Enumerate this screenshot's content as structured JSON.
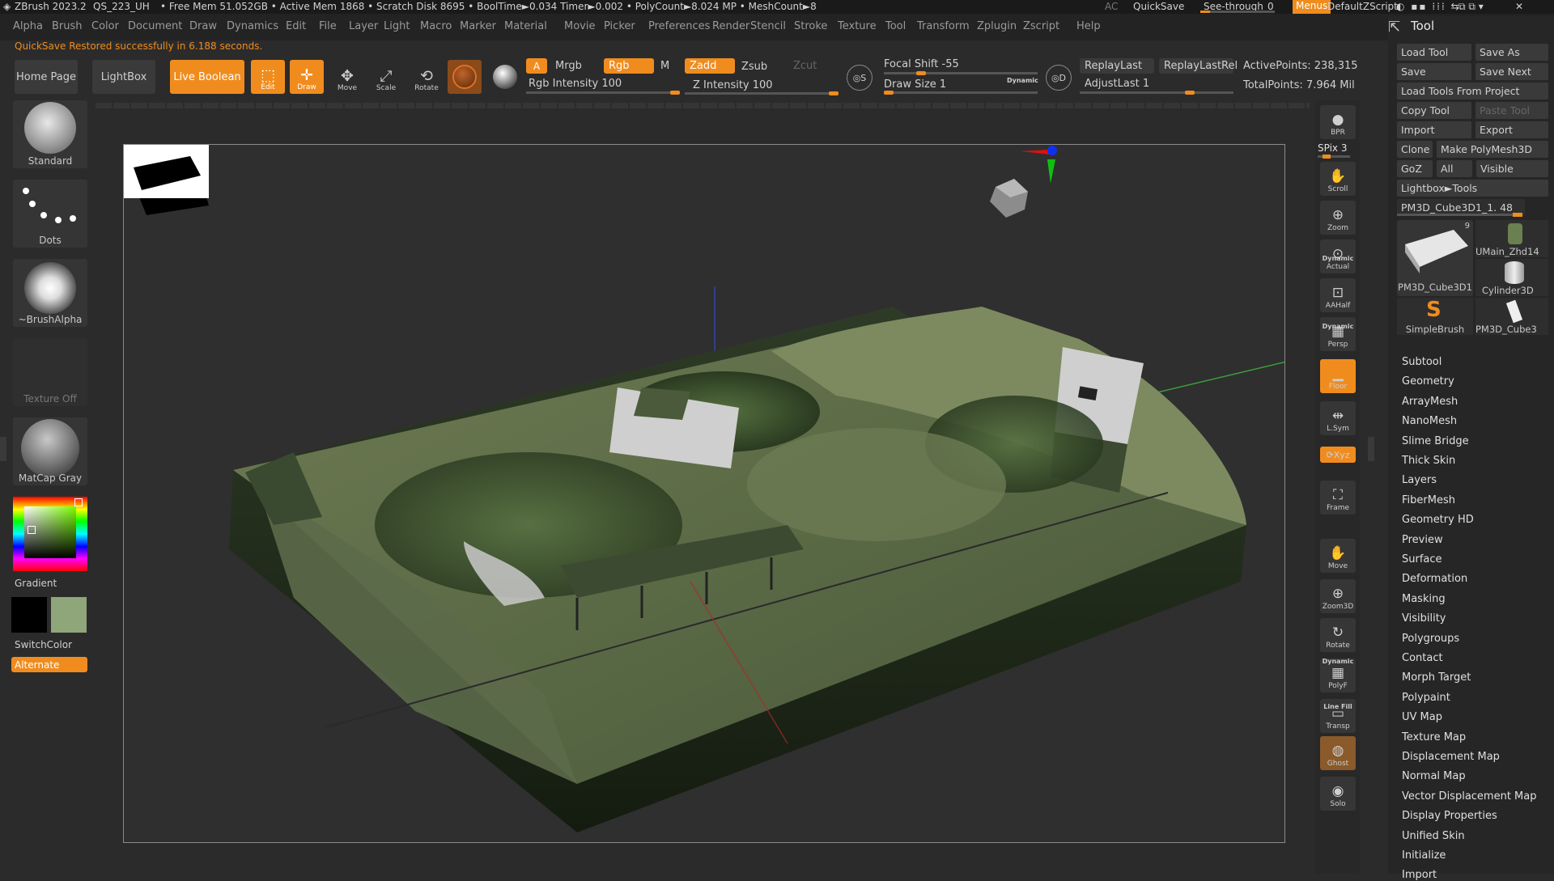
{
  "titlebar": {
    "app": "ZBrush 2023.2",
    "doc": "QS_223_UH",
    "stats": "• Free Mem 51.052GB • Active Mem 1868 • Scratch Disk 8695 • BoolTime►0.034 Timer►0.002 • PolyCount►8.024 MP • MeshCount►8",
    "ac": "AC",
    "quicksave": "QuickSave",
    "seethrough": "See-through",
    "seethrough_value": "0",
    "menus": "Menus",
    "script": "DefaultZScript"
  },
  "menubar": [
    "Alpha",
    "Brush",
    "Color",
    "Document",
    "Draw",
    "Dynamics",
    "Edit",
    "File",
    "Layer",
    "Light",
    "Macro",
    "Marker",
    "Material",
    "Movie",
    "Picker",
    "Preferences",
    "Render",
    "Stencil",
    "Stroke",
    "Texture",
    "Tool",
    "Transform",
    "Zplugin",
    "Zscript",
    "Help"
  ],
  "status_message": "QuickSave Restored successfully in 6.188 seconds.",
  "shelf": {
    "home_page": "Home Page",
    "lightbox": "LightBox",
    "live_boolean": "Live Boolean",
    "edit": "Edit",
    "draw": "Draw",
    "move": "Move",
    "scale": "Scale",
    "rotate": "Rotate",
    "a": "A",
    "mrgb": "Mrgb",
    "rgb": "Rgb",
    "m": "M",
    "zadd": "Zadd",
    "zsub": "Zsub",
    "zcut": "Zcut",
    "rgb_intensity": "Rgb Intensity 100",
    "z_intensity": "Z Intensity 100",
    "focal_shift": "Focal Shift -55",
    "draw_size": "Draw Size 1",
    "dynamic": "Dynamic",
    "replay_last": "ReplayLast",
    "replay_last_rel": "ReplayLastRel",
    "adjust_last": "AdjustLast 1",
    "active_points": "ActivePoints: 238,315",
    "total_points": "TotalPoints: 7.964 Mil"
  },
  "left_panel": {
    "brush": "Standard",
    "stroke": "Dots",
    "alpha": "~BrushAlpha",
    "texture": "Texture Off",
    "material": "MatCap Gray",
    "gradient": "Gradient",
    "switch_color": "SwitchColor",
    "alternate": "Alternate",
    "main_color": "#000000",
    "secondary_color": "#8fa57a"
  },
  "right_strip": [
    {
      "label": "BPR",
      "icon": "bpr-icon"
    },
    {
      "label": "SPix 3",
      "icon": "spix-slider"
    },
    {
      "label": "Scroll",
      "icon": "scroll-icon"
    },
    {
      "label": "Zoom",
      "icon": "zoom-icon"
    },
    {
      "label": "Actual",
      "icon": "actual-icon"
    },
    {
      "label": "AAHalf",
      "icon": "aahalf-icon"
    },
    {
      "label": "Persp",
      "icon": "persp-icon"
    },
    {
      "label": "Floor",
      "icon": "floor-icon"
    },
    {
      "label": "L.Sym",
      "icon": "lsym-icon"
    },
    {
      "label": "Xyz",
      "icon": "xyz-icon"
    },
    {
      "label": "Frame",
      "icon": "frame-icon"
    },
    {
      "label": "Move",
      "icon": "move-icon"
    },
    {
      "label": "Zoom3D",
      "icon": "zoom3d-icon"
    },
    {
      "label": "Rotate",
      "icon": "rotate-icon"
    },
    {
      "label": "PolyF",
      "icon": "polyf-icon"
    },
    {
      "label": "Transp",
      "icon": "transp-icon"
    },
    {
      "label": "Ghost",
      "icon": "ghost-icon"
    },
    {
      "label": "Solo",
      "icon": "solo-icon"
    }
  ],
  "right_strip_extra": {
    "dynamic": "Dynamic",
    "line_fill": "Line Fill"
  },
  "tool_panel": {
    "title": "Tool",
    "load_tool": "Load Tool",
    "save_as": "Save As",
    "save": "Save",
    "save_next": "Save Next",
    "load_from_project": "Load Tools From Project",
    "copy_tool": "Copy Tool",
    "paste_tool": "Paste Tool",
    "import": "Import",
    "export": "Export",
    "clone": "Clone",
    "make_polymesh": "Make PolyMesh3D",
    "goz": "GoZ",
    "all": "All",
    "visible": "Visible",
    "lightbox_tools": "Lightbox►Tools",
    "current_tool": "PM3D_Cube3D1_1. 48",
    "thumbs": [
      "PM3D_Cube3D1",
      "UMain_Zhd14",
      "Cylinder3D",
      "SimpleBrush",
      "PM3D_Cube3"
    ],
    "thumb_count": "9",
    "subpalettes": [
      "Subtool",
      "Geometry",
      "ArrayMesh",
      "NanoMesh",
      "Slime Bridge",
      "Thick Skin",
      "Layers",
      "FiberMesh",
      "Geometry HD",
      "Preview",
      "Surface",
      "Deformation",
      "Masking",
      "Visibility",
      "Polygroups",
      "Contact",
      "Morph Target",
      "Polypaint",
      "UV Map",
      "Texture Map",
      "Displacement Map",
      "Normal Map",
      "Vector Displacement Map",
      "Display Properties",
      "Unified Skin",
      "Initialize",
      "Import"
    ]
  },
  "colors": {
    "accent": "#f08c1e",
    "panel": "#2b2b2b",
    "viewport": "#2f2f2f"
  }
}
